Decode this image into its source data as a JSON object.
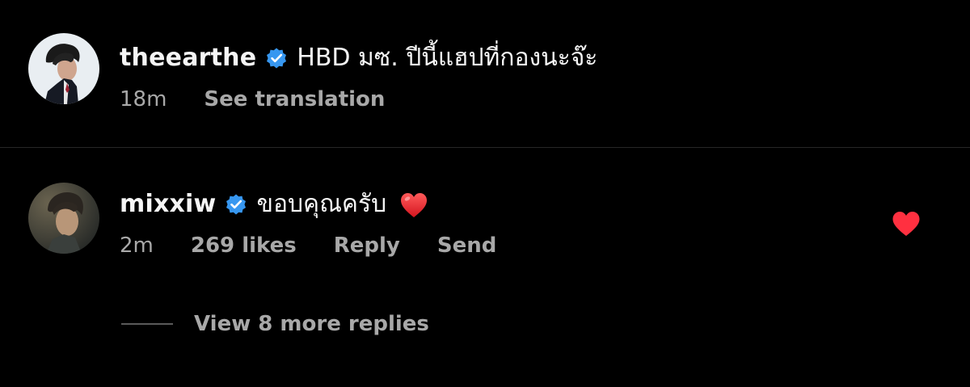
{
  "comments": [
    {
      "username": "theearthe",
      "verified": true,
      "text": "HBD มซ. ปีนี้แฮปที่กองนะจ๊ะ",
      "time": "18m",
      "see_translation": "See translation",
      "avatar_icon": "profile-photo-icon"
    },
    {
      "username": "mixxiw",
      "verified": true,
      "text": "ขอบคุณครับ",
      "emoji": "red-heart-emoji",
      "time": "2m",
      "likes": "269 likes",
      "reply": "Reply",
      "send": "Send",
      "liked": true,
      "avatar_icon": "profile-photo-icon"
    }
  ],
  "view_replies": "View 8 more replies",
  "colors": {
    "background": "#000000",
    "text_primary": "#f5f5f5",
    "text_secondary": "#a8a8a8",
    "verified_blue": "#3797f0",
    "like_red": "#ff3040",
    "divider": "#262626"
  }
}
